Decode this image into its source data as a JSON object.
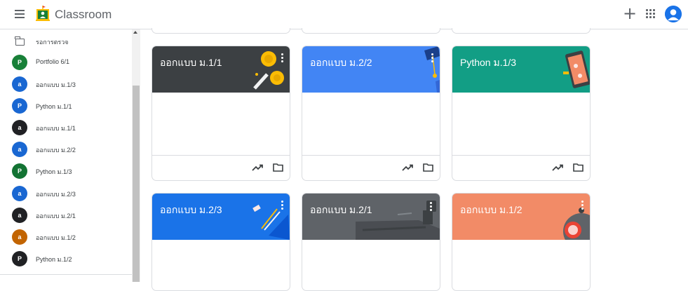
{
  "header": {
    "app_title": "Classroom",
    "icons": [
      "menu-icon",
      "classroom-logo",
      "plus-icon",
      "apps-grid-icon",
      "account-icon"
    ]
  },
  "sidebar": {
    "review": {
      "label": "รอการตรวจ",
      "icon": "review-folder-icon"
    },
    "classes": [
      {
        "initial": "P",
        "label": "Portfolio 6/1",
        "color": "#188038"
      },
      {
        "initial": "a",
        "label": "ออกแบบ ม.1/3",
        "color": "#1967d2"
      },
      {
        "initial": "P",
        "label": "Python ม.1/1",
        "color": "#1967d2"
      },
      {
        "initial": "a",
        "label": "ออกแบบ ม.1/1",
        "color": "#202124"
      },
      {
        "initial": "a",
        "label": "ออกแบบ ม.2/2",
        "color": "#1967d2"
      },
      {
        "initial": "P",
        "label": "Python ม.1/3",
        "color": "#137333"
      },
      {
        "initial": "a",
        "label": "ออกแบบ ม.2/3",
        "color": "#1967d2"
      },
      {
        "initial": "a",
        "label": "ออกแบบ ม.2/1",
        "color": "#202124"
      },
      {
        "initial": "a",
        "label": "ออกแบบ ม.1/2",
        "color": "#c26401"
      },
      {
        "initial": "P",
        "label": "Python ม.1/2",
        "color": "#202124"
      }
    ]
  },
  "cards": [
    {
      "title": "ออกแบบ ม.1/1",
      "color": "#3c4043"
    },
    {
      "title": "ออกแบบ ม.2/2",
      "color": "#4285f4"
    },
    {
      "title": "Python ม.1/3",
      "color": "#129e85"
    },
    {
      "title": "ออกแบบ ม.2/3",
      "color": "#1a73e8"
    },
    {
      "title": "ออกแบบ ม.2/1",
      "color": "#5f6368"
    },
    {
      "title": "ออกแบบ ม.1/2",
      "color": "#f28b67"
    }
  ]
}
